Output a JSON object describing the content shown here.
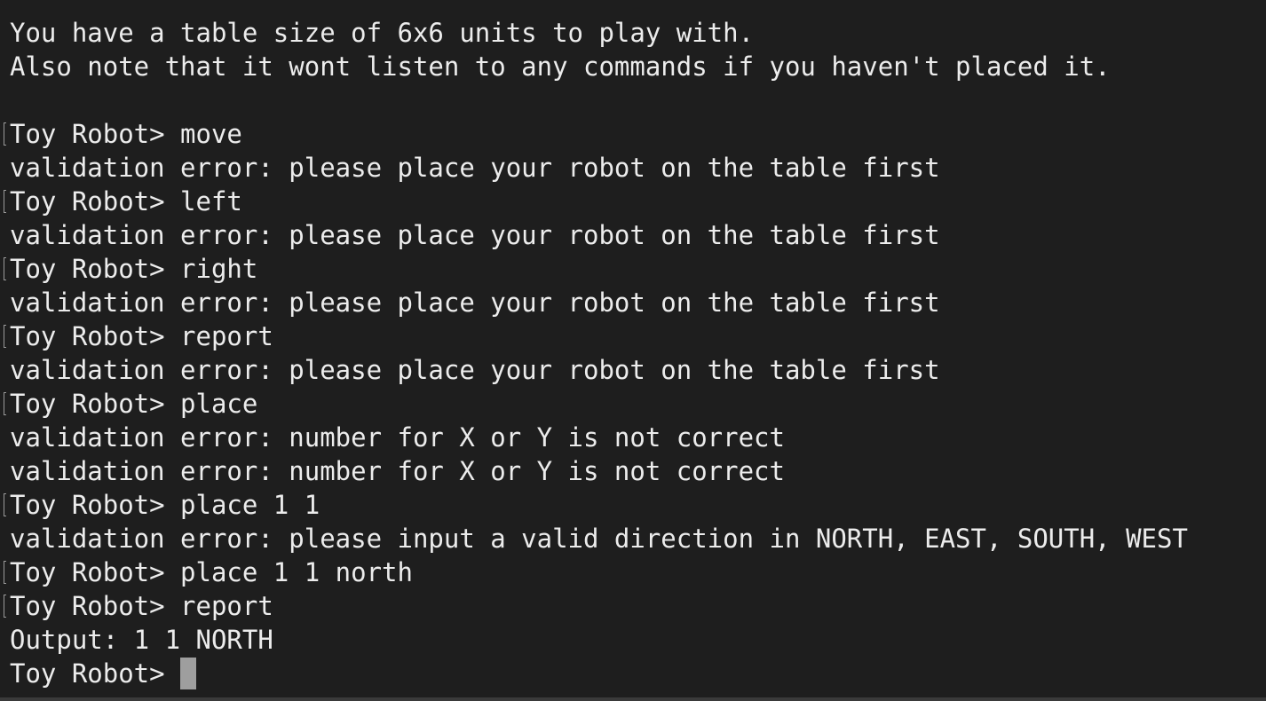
{
  "terminal": {
    "colors": {
      "background": "#1e1e1e",
      "text": "#ececec",
      "cursor": "#9e9e9e"
    },
    "lines": [
      {
        "text": "You have a table size of 6x6 units to play with.",
        "marked": false
      },
      {
        "text": "Also note that it wont listen to any commands if you haven't placed it.",
        "marked": false
      },
      {
        "text": "",
        "marked": false
      },
      {
        "text": "Toy Robot> move",
        "marked": true
      },
      {
        "text": "validation error: please place your robot on the table first",
        "marked": false
      },
      {
        "text": "Toy Robot> left",
        "marked": true
      },
      {
        "text": "validation error: please place your robot on the table first",
        "marked": false
      },
      {
        "text": "Toy Robot> right",
        "marked": true
      },
      {
        "text": "validation error: please place your robot on the table first",
        "marked": false
      },
      {
        "text": "Toy Robot> report",
        "marked": true
      },
      {
        "text": "validation error: please place your robot on the table first",
        "marked": false
      },
      {
        "text": "Toy Robot> place",
        "marked": true
      },
      {
        "text": "validation error: number for X or Y is not correct",
        "marked": false
      },
      {
        "text": "validation error: number for X or Y is not correct",
        "marked": false
      },
      {
        "text": "Toy Robot> place 1 1",
        "marked": true
      },
      {
        "text": "validation error: please input a valid direction in NORTH, EAST, SOUTH, WEST",
        "marked": false
      },
      {
        "text": "Toy Robot> place 1 1 north",
        "marked": true
      },
      {
        "text": "Toy Robot> report",
        "marked": true
      },
      {
        "text": "Output: 1 1 NORTH",
        "marked": false
      }
    ],
    "prompt": "Toy Robot> "
  }
}
